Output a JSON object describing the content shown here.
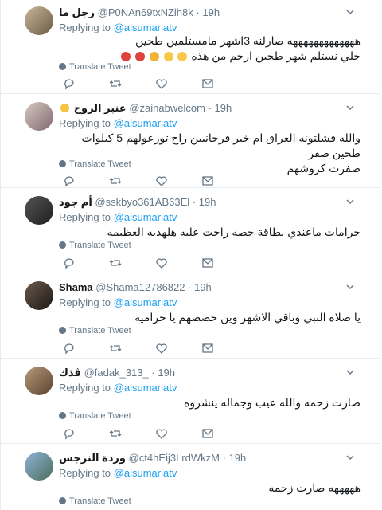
{
  "tweets": [
    {
      "name": "رجل ما",
      "handle": "@P0NAn69txNZih8k",
      "time": "19h",
      "replying_prefix": "Replying to",
      "replying_to": "@alsumariatv",
      "lines": [
        "هههههههههههههه صارلنه 3اشهر مامستلمين طحين",
        "خلي نستلم شهر طحين ارحم من هذه"
      ],
      "emojis": [
        "laughing-emoji",
        "laughing-emoji",
        "pensive-emoji",
        "angry-emoji",
        "angry-emoji"
      ],
      "translate": "Translate Tweet"
    },
    {
      "name": "عنبر الروح",
      "handle": "@zainabwelcom",
      "time": "19h",
      "replying_prefix": "Replying to",
      "replying_to": "@alsumariatv",
      "lines": [
        "والله فشلتونه العراق ام خير فرحانيين راح توزعولهم 5 كيلوات طحين صفر",
        "صفرت كروشهم"
      ],
      "translate": "Translate Tweet"
    },
    {
      "name": "أم جود",
      "handle": "@sskbyo361AB63El",
      "time": "19h",
      "replying_prefix": "Replying to",
      "replying_to": "@alsumariatv",
      "lines": [
        "حرامات ماعندي بطاقة حصه راحت عليه هلهديه العظيمه"
      ],
      "translate": "Translate Tweet"
    },
    {
      "name": "Shama",
      "handle": "@Shama12786822",
      "time": "19h",
      "replying_prefix": "Replying to",
      "replying_to": "@alsumariatv",
      "lines": [
        "يا صلاة النبي وباقي الاشهر وين حصصهم يا حرامية"
      ],
      "translate": "Translate Tweet"
    },
    {
      "name": "ڤذك",
      "handle": "@fadak_313_",
      "time": "19h",
      "replying_prefix": "Replying to",
      "replying_to": "@alsumariatv",
      "lines": [
        "صارت زحمه والله عيب وجماله ينشروه"
      ],
      "translate": "Translate Tweet"
    },
    {
      "name": "وردة النرجس",
      "handle": "@ct4hEij3LrdWkzM",
      "time": "19h",
      "replying_prefix": "Replying to",
      "replying_to": "@alsumariatv",
      "lines": [
        "هههههه صارت زحمه"
      ],
      "translate": "Translate Tweet"
    }
  ],
  "colors": {
    "link": "#1da1f2",
    "muted": "#657786",
    "border": "#e6ecf0"
  },
  "icons": [
    "chevron-down-icon",
    "reply-icon",
    "retweet-icon",
    "like-icon",
    "message-icon",
    "globe-icon"
  ]
}
